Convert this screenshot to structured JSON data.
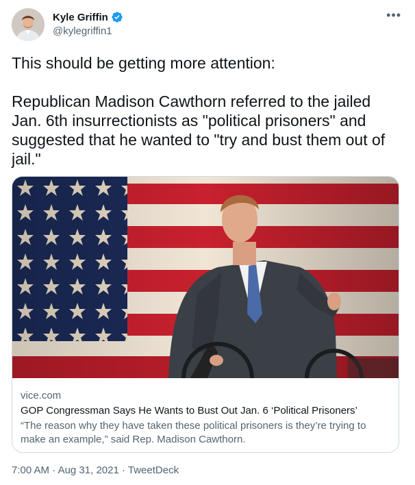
{
  "author": {
    "display_name": "Kyle Griffin",
    "handle": "@kylegriffin1",
    "verified_icon": "verified-badge-icon",
    "avatar_icon": "avatar"
  },
  "more_glyph": "•••",
  "tweet": {
    "text": "This should be getting more attention:\n\nRepublican Madison Cawthorn referred to the jailed Jan. 6th insurrectionists as \"political prisoners\" and suggested that he wanted to \"try and bust them out of jail.\""
  },
  "card": {
    "domain": "vice.com",
    "title": "GOP Congressman Says He Wants to Bust Out Jan. 6 ‘Political Prisoners’",
    "description": "“The reason why they have taken these political prisoners is they’re trying to make an example,” said Rep. Madison Cawthorn.",
    "colors": {
      "flag_red": "#c8202e",
      "flag_blue": "#1b2a57",
      "stripe_white": "#f1e6d6"
    }
  },
  "footer": {
    "time": "7:00 AM",
    "date": "Aug 31, 2021",
    "source": "TweetDeck",
    "separator": "·"
  },
  "colors": {
    "text": "#0f1419",
    "secondary": "#536471",
    "verified": "#1d9bf0",
    "border": "#cfd9de"
  }
}
